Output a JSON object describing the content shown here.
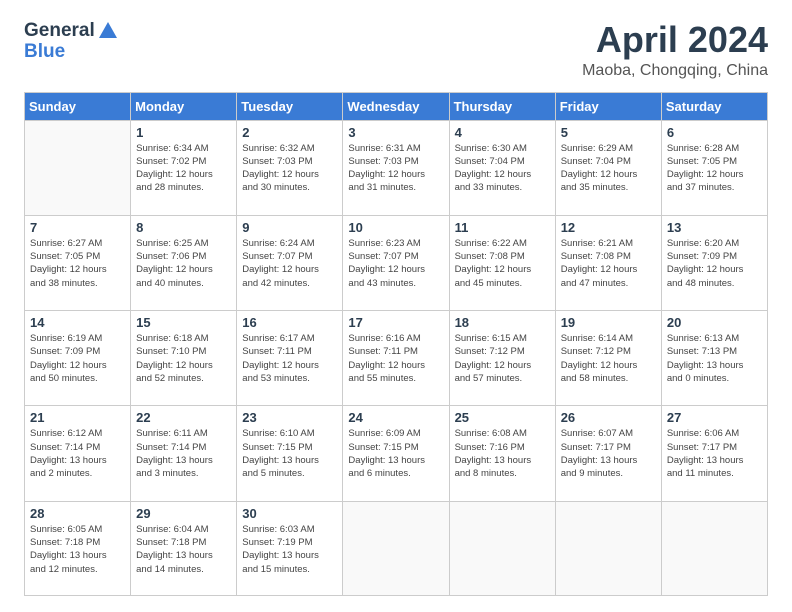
{
  "header": {
    "logo_line1": "General",
    "logo_line2": "Blue",
    "title": "April 2024",
    "subtitle": "Maoba, Chongqing, China"
  },
  "days_of_week": [
    "Sunday",
    "Monday",
    "Tuesday",
    "Wednesday",
    "Thursday",
    "Friday",
    "Saturday"
  ],
  "weeks": [
    [
      {
        "day": "",
        "info": ""
      },
      {
        "day": "1",
        "info": "Sunrise: 6:34 AM\nSunset: 7:02 PM\nDaylight: 12 hours\nand 28 minutes."
      },
      {
        "day": "2",
        "info": "Sunrise: 6:32 AM\nSunset: 7:03 PM\nDaylight: 12 hours\nand 30 minutes."
      },
      {
        "day": "3",
        "info": "Sunrise: 6:31 AM\nSunset: 7:03 PM\nDaylight: 12 hours\nand 31 minutes."
      },
      {
        "day": "4",
        "info": "Sunrise: 6:30 AM\nSunset: 7:04 PM\nDaylight: 12 hours\nand 33 minutes."
      },
      {
        "day": "5",
        "info": "Sunrise: 6:29 AM\nSunset: 7:04 PM\nDaylight: 12 hours\nand 35 minutes."
      },
      {
        "day": "6",
        "info": "Sunrise: 6:28 AM\nSunset: 7:05 PM\nDaylight: 12 hours\nand 37 minutes."
      }
    ],
    [
      {
        "day": "7",
        "info": "Sunrise: 6:27 AM\nSunset: 7:05 PM\nDaylight: 12 hours\nand 38 minutes."
      },
      {
        "day": "8",
        "info": "Sunrise: 6:25 AM\nSunset: 7:06 PM\nDaylight: 12 hours\nand 40 minutes."
      },
      {
        "day": "9",
        "info": "Sunrise: 6:24 AM\nSunset: 7:07 PM\nDaylight: 12 hours\nand 42 minutes."
      },
      {
        "day": "10",
        "info": "Sunrise: 6:23 AM\nSunset: 7:07 PM\nDaylight: 12 hours\nand 43 minutes."
      },
      {
        "day": "11",
        "info": "Sunrise: 6:22 AM\nSunset: 7:08 PM\nDaylight: 12 hours\nand 45 minutes."
      },
      {
        "day": "12",
        "info": "Sunrise: 6:21 AM\nSunset: 7:08 PM\nDaylight: 12 hours\nand 47 minutes."
      },
      {
        "day": "13",
        "info": "Sunrise: 6:20 AM\nSunset: 7:09 PM\nDaylight: 12 hours\nand 48 minutes."
      }
    ],
    [
      {
        "day": "14",
        "info": "Sunrise: 6:19 AM\nSunset: 7:09 PM\nDaylight: 12 hours\nand 50 minutes."
      },
      {
        "day": "15",
        "info": "Sunrise: 6:18 AM\nSunset: 7:10 PM\nDaylight: 12 hours\nand 52 minutes."
      },
      {
        "day": "16",
        "info": "Sunrise: 6:17 AM\nSunset: 7:11 PM\nDaylight: 12 hours\nand 53 minutes."
      },
      {
        "day": "17",
        "info": "Sunrise: 6:16 AM\nSunset: 7:11 PM\nDaylight: 12 hours\nand 55 minutes."
      },
      {
        "day": "18",
        "info": "Sunrise: 6:15 AM\nSunset: 7:12 PM\nDaylight: 12 hours\nand 57 minutes."
      },
      {
        "day": "19",
        "info": "Sunrise: 6:14 AM\nSunset: 7:12 PM\nDaylight: 12 hours\nand 58 minutes."
      },
      {
        "day": "20",
        "info": "Sunrise: 6:13 AM\nSunset: 7:13 PM\nDaylight: 13 hours\nand 0 minutes."
      }
    ],
    [
      {
        "day": "21",
        "info": "Sunrise: 6:12 AM\nSunset: 7:14 PM\nDaylight: 13 hours\nand 2 minutes."
      },
      {
        "day": "22",
        "info": "Sunrise: 6:11 AM\nSunset: 7:14 PM\nDaylight: 13 hours\nand 3 minutes."
      },
      {
        "day": "23",
        "info": "Sunrise: 6:10 AM\nSunset: 7:15 PM\nDaylight: 13 hours\nand 5 minutes."
      },
      {
        "day": "24",
        "info": "Sunrise: 6:09 AM\nSunset: 7:15 PM\nDaylight: 13 hours\nand 6 minutes."
      },
      {
        "day": "25",
        "info": "Sunrise: 6:08 AM\nSunset: 7:16 PM\nDaylight: 13 hours\nand 8 minutes."
      },
      {
        "day": "26",
        "info": "Sunrise: 6:07 AM\nSunset: 7:17 PM\nDaylight: 13 hours\nand 9 minutes."
      },
      {
        "day": "27",
        "info": "Sunrise: 6:06 AM\nSunset: 7:17 PM\nDaylight: 13 hours\nand 11 minutes."
      }
    ],
    [
      {
        "day": "28",
        "info": "Sunrise: 6:05 AM\nSunset: 7:18 PM\nDaylight: 13 hours\nand 12 minutes."
      },
      {
        "day": "29",
        "info": "Sunrise: 6:04 AM\nSunset: 7:18 PM\nDaylight: 13 hours\nand 14 minutes."
      },
      {
        "day": "30",
        "info": "Sunrise: 6:03 AM\nSunset: 7:19 PM\nDaylight: 13 hours\nand 15 minutes."
      },
      {
        "day": "",
        "info": ""
      },
      {
        "day": "",
        "info": ""
      },
      {
        "day": "",
        "info": ""
      },
      {
        "day": "",
        "info": ""
      }
    ]
  ]
}
